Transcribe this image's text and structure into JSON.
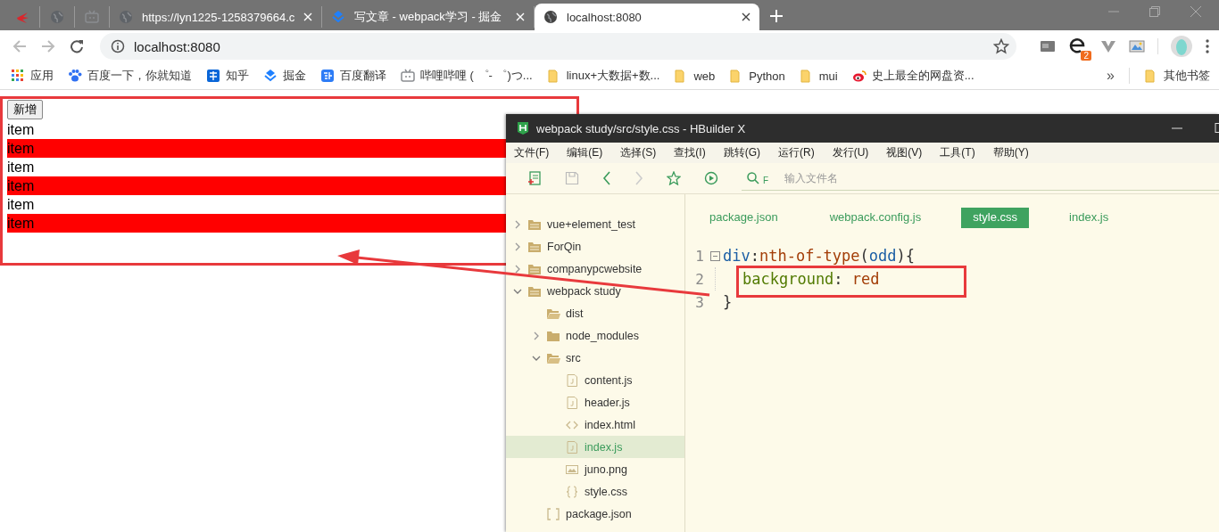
{
  "browser": {
    "tabs": [
      {
        "kind": "pinned",
        "selected": false
      },
      {
        "kind": "pinned",
        "selected": false
      },
      {
        "kind": "pinned",
        "selected": false
      },
      {
        "kind": "page",
        "title": "https://lyn1225-1258379664.c",
        "selected": false
      },
      {
        "kind": "page",
        "title": "写文章 - webpack学习 - 掘金",
        "selected": false
      },
      {
        "kind": "page",
        "title": "localhost:8080",
        "selected": true
      }
    ],
    "address": "localhost:8080",
    "extension_badge": "2",
    "bookmarks": [
      {
        "kind": "apps",
        "label": "应用"
      },
      {
        "kind": "paw",
        "label": "百度一下，你就知道"
      },
      {
        "kind": "zhi",
        "label": "知乎"
      },
      {
        "kind": "chevrons",
        "label": "掘金"
      },
      {
        "kind": "translate",
        "label": "百度翻译"
      },
      {
        "kind": "tv",
        "label": "哔哩哔哩 ( ゜- ゜)つ..."
      },
      {
        "kind": "folder",
        "label": "linux+大数据+数..."
      },
      {
        "kind": "folder",
        "label": "web"
      },
      {
        "kind": "folder",
        "label": "Python"
      },
      {
        "kind": "folder",
        "label": "mui"
      },
      {
        "kind": "eye",
        "label": "史上最全的网盘资..."
      }
    ],
    "overflow": "»",
    "other_bookmarks": "其他书签"
  },
  "page": {
    "button": "新增",
    "items": [
      {
        "text": "item",
        "highlighted": false
      },
      {
        "text": "item",
        "highlighted": true
      },
      {
        "text": "item",
        "highlighted": false
      },
      {
        "text": "item",
        "highlighted": true
      },
      {
        "text": "item",
        "highlighted": false
      },
      {
        "text": "item",
        "highlighted": true
      }
    ]
  },
  "editor": {
    "title": "webpack study/src/style.css - HBuilder X",
    "menu": [
      "文件(F)",
      "编辑(E)",
      "选择(S)",
      "查找(I)",
      "跳转(G)",
      "运行(R)",
      "发行(U)",
      "视图(V)",
      "工具(T)",
      "帮助(Y)"
    ],
    "search": {
      "prefix": "F",
      "placeholder": "输入文件名"
    },
    "tree": [
      {
        "label": "vue+element_test",
        "kind": "project",
        "expanded": false,
        "selected": false
      },
      {
        "label": "ForQin",
        "kind": "project",
        "expanded": false,
        "selected": false
      },
      {
        "label": "companypcwebsite",
        "kind": "project",
        "expanded": false,
        "selected": false
      },
      {
        "label": "webpack study",
        "kind": "project",
        "expanded": true,
        "selected": false,
        "children": [
          {
            "label": "dist",
            "kind": "folder-open",
            "selected": false
          },
          {
            "label": "node_modules",
            "kind": "folder",
            "expanded": false,
            "selected": false
          },
          {
            "label": "src",
            "kind": "folder-open",
            "expanded": true,
            "selected": false,
            "children": [
              {
                "label": "content.js",
                "kind": "js",
                "selected": false
              },
              {
                "label": "header.js",
                "kind": "js",
                "selected": false
              },
              {
                "label": "index.html",
                "kind": "html",
                "selected": false
              },
              {
                "label": "index.js",
                "kind": "js",
                "selected": true
              },
              {
                "label": "juno.png",
                "kind": "image",
                "selected": false
              },
              {
                "label": "style.css",
                "kind": "css",
                "selected": false
              }
            ]
          },
          {
            "label": "package.json",
            "kind": "json",
            "selected": false
          }
        ]
      }
    ],
    "tabs": [
      {
        "label": "package.json",
        "selected": false
      },
      {
        "label": "webpack.config.js",
        "selected": false
      },
      {
        "label": "style.css",
        "selected": true
      },
      {
        "label": "index.js",
        "selected": false
      }
    ],
    "lines": [
      {
        "number": "1",
        "foldable": true,
        "indented": false,
        "tokens": [
          {
            "text": "div",
            "kind": "selector"
          },
          {
            "text": ":",
            "kind": "punct"
          },
          {
            "text": "nth-of-type",
            "kind": "pseudo"
          },
          {
            "text": "(",
            "kind": "punct"
          },
          {
            "text": "odd",
            "kind": "selector"
          },
          {
            "text": "){",
            "kind": "punct"
          }
        ]
      },
      {
        "number": "2",
        "foldable": false,
        "indented": true,
        "tokens": [
          {
            "text": "background",
            "kind": "property"
          },
          {
            "text": ": ",
            "kind": "punct"
          },
          {
            "text": "red",
            "kind": "value"
          }
        ]
      },
      {
        "number": "3",
        "foldable": false,
        "indented": false,
        "tokens": [
          {
            "text": "}",
            "kind": "punct"
          }
        ]
      }
    ]
  }
}
